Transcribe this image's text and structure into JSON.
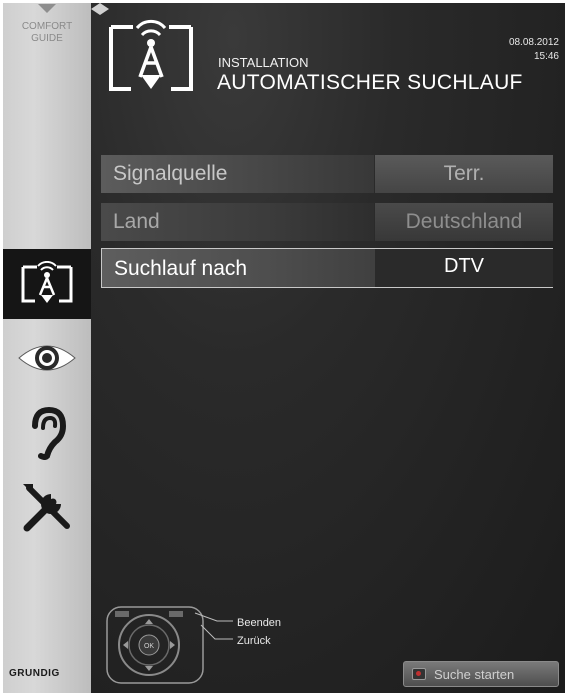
{
  "sidebar": {
    "guide_line1": "COMFORT",
    "guide_line2": "GUIDE",
    "items": [
      {
        "name": "installation",
        "icon": "antenna-icon",
        "active": true
      },
      {
        "name": "picture",
        "icon": "eye-icon",
        "active": false
      },
      {
        "name": "sound",
        "icon": "ear-icon",
        "active": false
      },
      {
        "name": "settings",
        "icon": "tools-icon",
        "active": false
      }
    ],
    "brand": "GRUNDIG"
  },
  "header": {
    "section": "INSTALLATION",
    "title": "AUTOMATISCHER SUCHLAUF",
    "date": "08.08.2012",
    "time": "15:46"
  },
  "settings": [
    {
      "label": "Signalquelle",
      "value": "Terr."
    },
    {
      "label": "Land",
      "value": "Deutschland"
    },
    {
      "label": "Suchlauf nach",
      "value": "DTV"
    }
  ],
  "footer": {
    "exit_label": "Beenden",
    "back_label": "Zurück",
    "start_button": "Suche starten",
    "ok_label": "OK"
  },
  "colors": {
    "background": "#1e1e1e",
    "sidebar": "#cfcfcf",
    "highlight_border": "#c8c8c8",
    "record_red": "#c03030"
  }
}
